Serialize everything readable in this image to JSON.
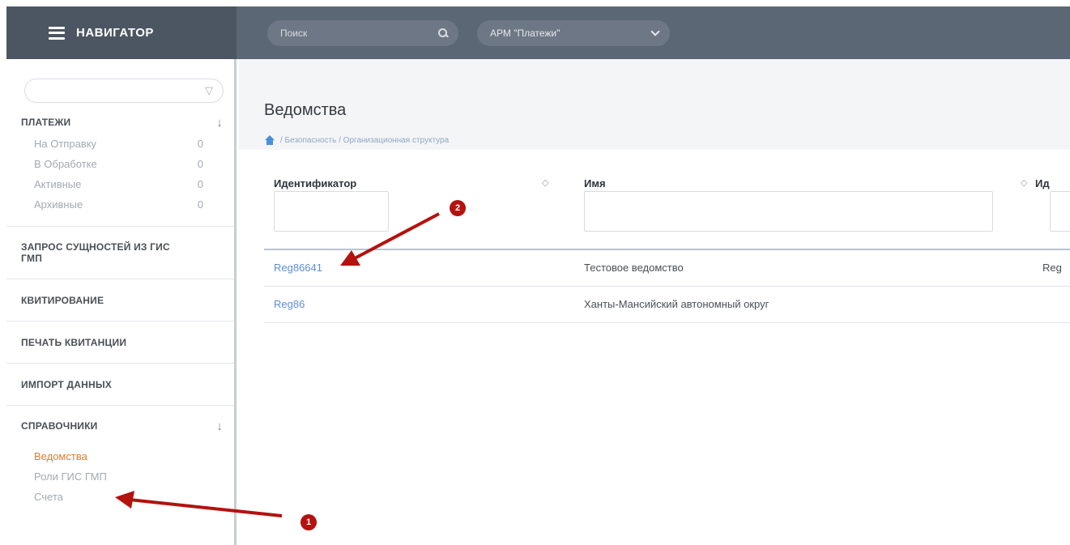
{
  "header": {
    "brand": "НАВИГАТОР",
    "search_placeholder": "Поиск",
    "workspace": "АРМ \"Платежи\""
  },
  "sidebar": {
    "payments": {
      "title": "ПЛАТЕЖИ",
      "items": [
        {
          "label": "На Отправку",
          "count": "0"
        },
        {
          "label": "В Обработке",
          "count": "0"
        },
        {
          "label": "Активные",
          "count": "0"
        },
        {
          "label": "Архивные",
          "count": "0"
        }
      ]
    },
    "sections": [
      "ЗАПРОС СУЩНОСТЕЙ ИЗ ГИС ГМП",
      "КВИТИРОВАНИЕ",
      "ПЕЧАТЬ КВИТАНЦИИ",
      "ИМПОРТ ДАННЫХ"
    ],
    "directories": {
      "title": "СПРАВОЧНИКИ",
      "items": [
        "Ведомства",
        "Роли ГИС ГМП",
        "Счета"
      ]
    }
  },
  "page": {
    "title": "Ведомства",
    "breadcrumb": "/ Безопасность / Организационная структура"
  },
  "table": {
    "columns": [
      "Идентификатор",
      "Имя",
      "Ид"
    ],
    "rows": [
      {
        "id": "Reg86641",
        "name": "Тестовое ведомство",
        "extra": "Reg"
      },
      {
        "id": "Reg86",
        "name": "Ханты-Мансийский автономный округ",
        "extra": ""
      }
    ]
  },
  "annotations": {
    "badge1": "1",
    "badge2": "2",
    "arrow_color": "#b3120f"
  },
  "colors": {
    "brand_bg": "#4c5662",
    "topbar_bg": "#5c6775",
    "link": "#5b8fd6",
    "active_menu": "#e07c2f"
  }
}
